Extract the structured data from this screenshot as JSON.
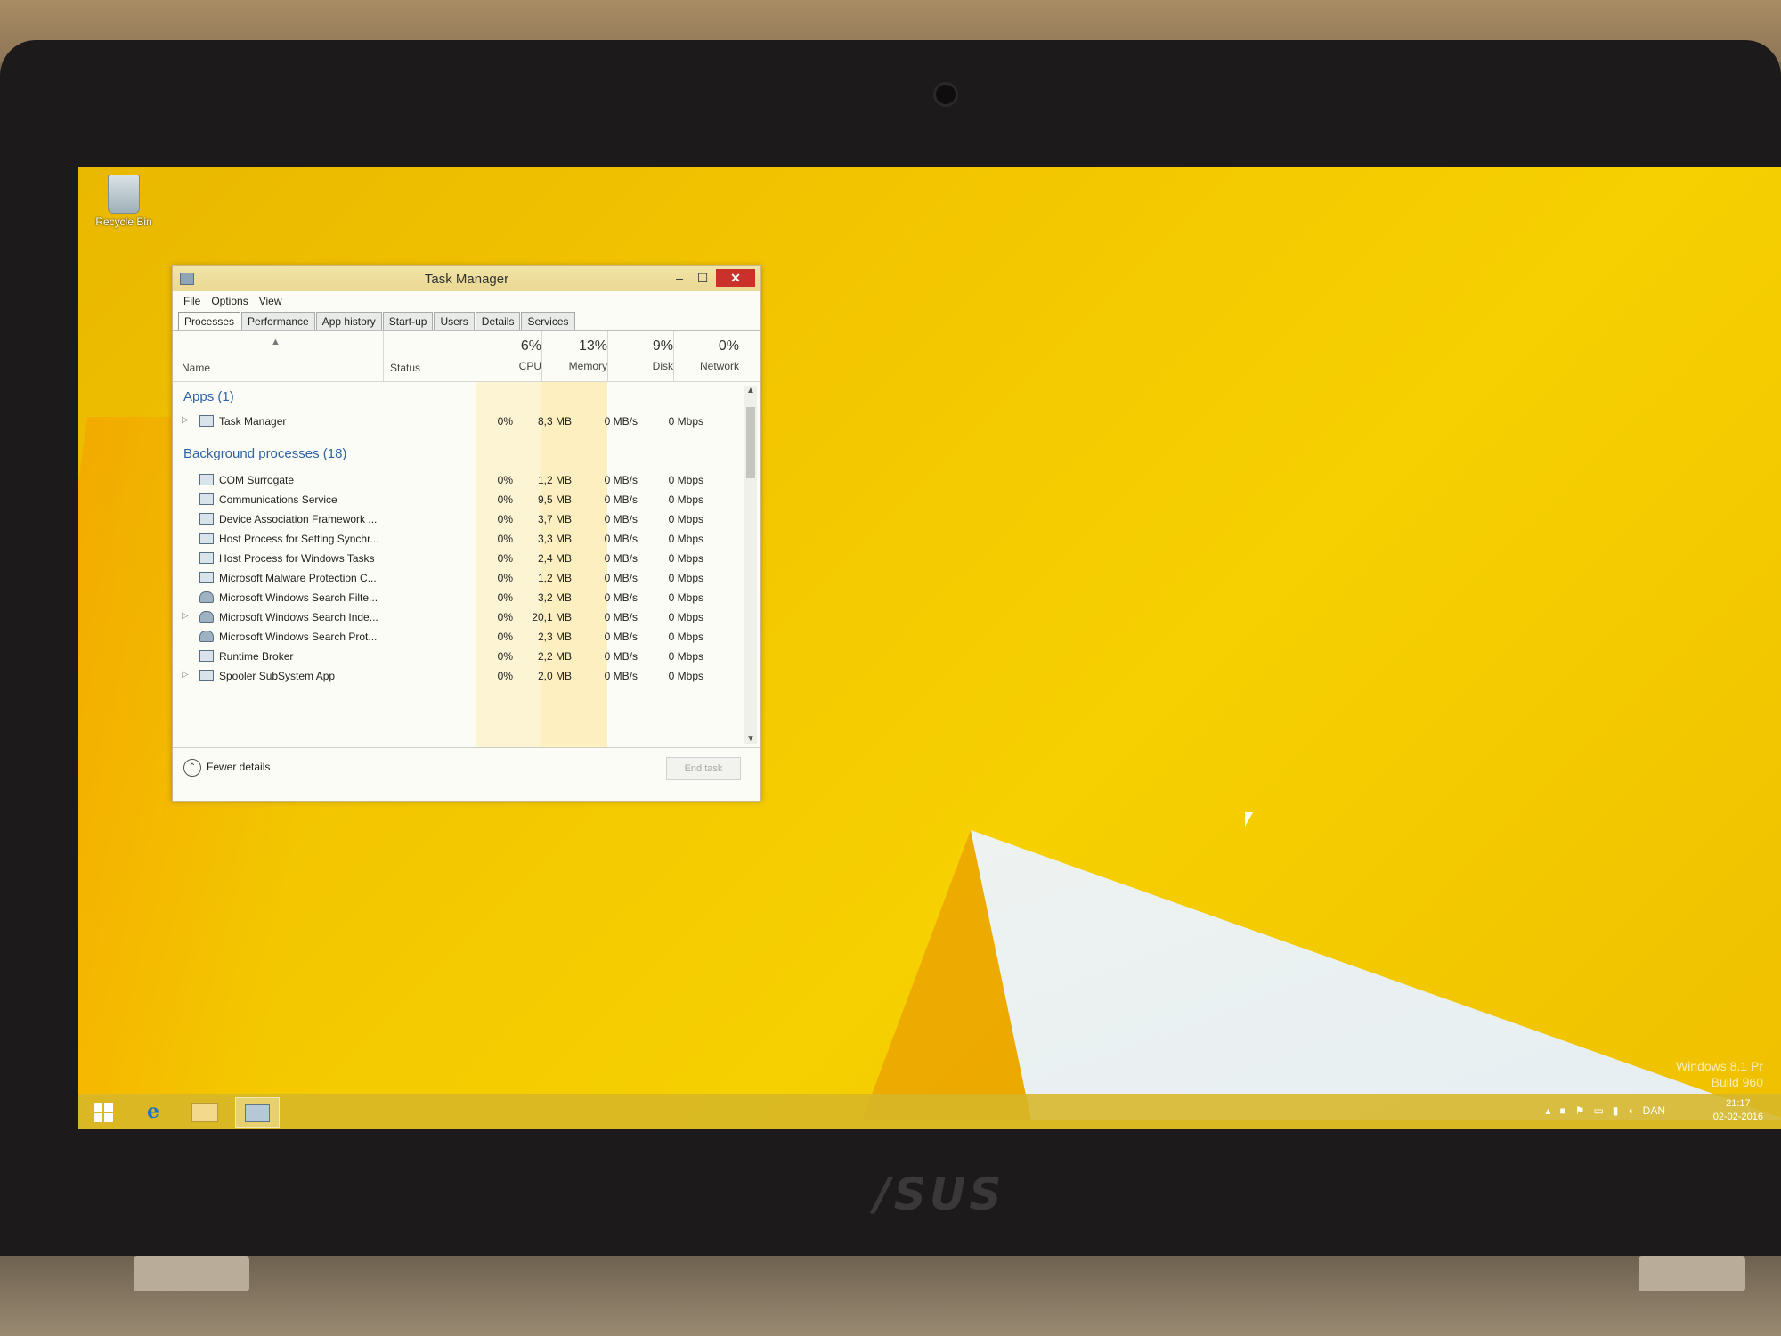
{
  "desktop": {
    "recycle_bin_label": "Recycle Bin"
  },
  "task_manager": {
    "title": "Task Manager",
    "menu": [
      "File",
      "Options",
      "View"
    ],
    "tabs": [
      "Processes",
      "Performance",
      "App history",
      "Start-up",
      "Users",
      "Details",
      "Services"
    ],
    "columns": {
      "name": "Name",
      "status": "Status",
      "cpu": {
        "pct": "6%",
        "label": "CPU"
      },
      "memory": {
        "pct": "13%",
        "label": "Memory"
      },
      "disk": {
        "pct": "9%",
        "label": "Disk"
      },
      "network": {
        "pct": "0%",
        "label": "Network"
      }
    },
    "groups": {
      "apps": "Apps (1)",
      "background": "Background processes (18)"
    },
    "apps": [
      {
        "name": "Task Manager",
        "cpu": "0%",
        "mem": "8,3 MB",
        "disk": "0 MB/s",
        "net": "0 Mbps"
      }
    ],
    "background": [
      {
        "name": "COM Surrogate",
        "cpu": "0%",
        "mem": "1,2 MB",
        "disk": "0 MB/s",
        "net": "0 Mbps"
      },
      {
        "name": "Communications Service",
        "cpu": "0%",
        "mem": "9,5 MB",
        "disk": "0 MB/s",
        "net": "0 Mbps"
      },
      {
        "name": "Device Association Framework ...",
        "cpu": "0%",
        "mem": "3,7 MB",
        "disk": "0 MB/s",
        "net": "0 Mbps"
      },
      {
        "name": "Host Process for Setting Synchr...",
        "cpu": "0%",
        "mem": "3,3 MB",
        "disk": "0 MB/s",
        "net": "0 Mbps"
      },
      {
        "name": "Host Process for Windows Tasks",
        "cpu": "0%",
        "mem": "2,4 MB",
        "disk": "0 MB/s",
        "net": "0 Mbps"
      },
      {
        "name": "Microsoft Malware Protection C...",
        "cpu": "0%",
        "mem": "1,2 MB",
        "disk": "0 MB/s",
        "net": "0 Mbps"
      },
      {
        "name": "Microsoft Windows Search Filte...",
        "cpu": "0%",
        "mem": "3,2 MB",
        "disk": "0 MB/s",
        "net": "0 Mbps"
      },
      {
        "name": "Microsoft Windows Search Inde...",
        "cpu": "0%",
        "mem": "20,1 MB",
        "disk": "0 MB/s",
        "net": "0 Mbps"
      },
      {
        "name": "Microsoft Windows Search Prot...",
        "cpu": "0%",
        "mem": "2,3 MB",
        "disk": "0 MB/s",
        "net": "0 Mbps"
      },
      {
        "name": "Runtime Broker",
        "cpu": "0%",
        "mem": "2,2 MB",
        "disk": "0 MB/s",
        "net": "0 Mbps"
      },
      {
        "name": "Spooler SubSystem App",
        "cpu": "0%",
        "mem": "2,0 MB",
        "disk": "0 MB/s",
        "net": "0 Mbps"
      }
    ],
    "footer": {
      "fewer_details": "Fewer details",
      "end_task": "End task"
    }
  },
  "taskbar": {
    "language": "DAN",
    "time": "21:17",
    "date": "02-02-2016"
  },
  "watermark": {
    "line1": "Windows 8.1 Pr",
    "line2": "Build 960"
  },
  "laptop": {
    "brand": "/SUS"
  }
}
